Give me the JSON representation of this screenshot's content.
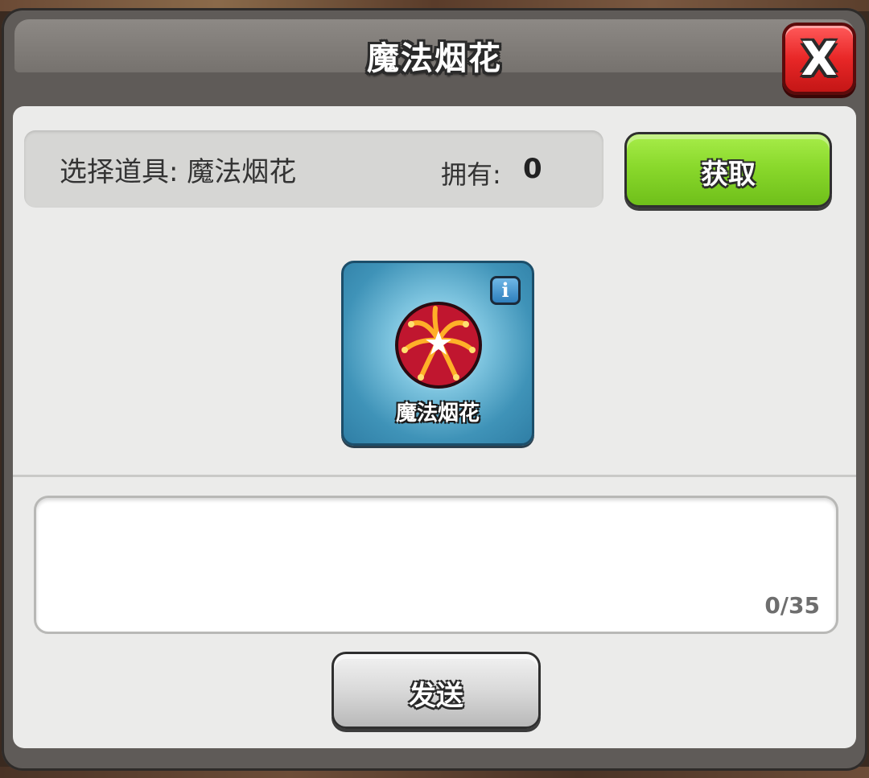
{
  "dialog": {
    "title": "魔法烟花",
    "close_label": "X"
  },
  "selection": {
    "label": "选择道具: 魔法烟花",
    "own_label": "拥有:",
    "own_count": "0",
    "get_button_label": "获取"
  },
  "item": {
    "name": "魔法烟花",
    "info_label": "i",
    "icon": "firework-icon"
  },
  "message": {
    "value": "",
    "char_count": "0/35"
  },
  "send_button_label": "发送",
  "colors": {
    "close_red": "#e82727",
    "get_green": "#8ad92c",
    "card_blue": "#3f93b8",
    "panel_bg": "#ebebea"
  }
}
